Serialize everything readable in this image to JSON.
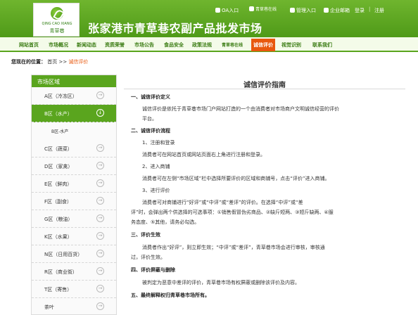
{
  "header": {
    "logo_en": "QING CAO XIANG",
    "logo_cn": "青草巷",
    "title": "张家港市青草巷农副产品批发市场",
    "links": [
      "OA入口",
      "青草巷在线",
      "管理入口",
      "企业邮箱",
      "登录",
      "注册"
    ]
  },
  "nav": {
    "items": [
      "网站首页",
      "市场概况",
      "新闻动态",
      "资质荣誉",
      "市场公告",
      "食品安全",
      "政策法规",
      "青草巷在线",
      "诚信评价",
      "视觉识别",
      "联系我们"
    ],
    "active_index": 8
  },
  "breadcrumb": {
    "prefix": "您现在的位置：",
    "home": "首页",
    "sep": ">>",
    "current": "诚信评价"
  },
  "sidebar": {
    "title": "市场区域",
    "items": [
      {
        "label": "A区（冷冻区）"
      },
      {
        "label": "B区（水产）",
        "active": true
      },
      {
        "label": "B区-水产",
        "sub": true
      },
      {
        "label": "C区（蔬菜）"
      },
      {
        "label": "D区（家禽）"
      },
      {
        "label": "E区（鲜肉）"
      },
      {
        "label": "F区（副食）"
      },
      {
        "label": "G区（粮油）"
      },
      {
        "label": "K区（水果）"
      },
      {
        "label": "N区（日用百货）"
      },
      {
        "label": "R区（商业街）"
      },
      {
        "label": "T区（寄售）"
      },
      {
        "label": "茶叶"
      }
    ]
  },
  "article": {
    "title": "诚信评价指南",
    "s1_h": "一、诚信评价定义",
    "s1_p1": "诚信评价是依托于青草巷市场门户网站打造的一个由消费者对市场商户文明诚信经营的评价",
    "s1_p2": "平台。",
    "s2_h": "二、诚信评价流程",
    "s2_1": "1、注册和登录",
    "s2_1p": "消费者可在网站首页或网站页面右上角进行注册和登录。",
    "s2_2": "2、进入商铺",
    "s2_2p": "消费者可在左侧“市场区域”栏中选择所要评价的区域和商铺号，点击“评价”进入商铺。",
    "s2_3": "3、进行评价",
    "s2_3p1": "消费者可对商铺进行“好评”或“中评”或“差评”的评价。在选择“中评”或“差",
    "s2_3p2": "评”时，会弹出两个供选择的可选事项：①销售假冒伪劣商品、②缺斤短两、③短斤缺两、④服",
    "s2_3p3": "务态度、⑤其他，请务必勾选。",
    "s3_h": "三、评价生效",
    "s3_p1": "消费者作出“好评”，则立即生效；“中评”或“差评”，青草巷市场会进行审核，审核通",
    "s3_p2": "过，评价生效。",
    "s4_h": "四、评价屏蔽与删除",
    "s4_p": "被判定为恶意中差评的评价，青草巷市场有权屏蔽或删除该评价及内容。",
    "s5_h": "五、最终解释权归青草巷市场所有。"
  },
  "colors": {
    "green": "#5aa51e",
    "orange": "#e8580e"
  }
}
